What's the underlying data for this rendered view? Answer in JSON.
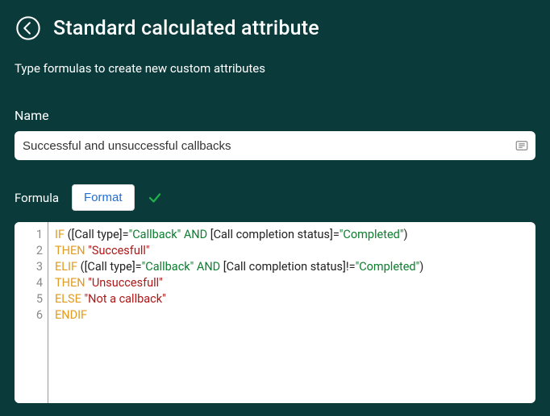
{
  "header": {
    "title": "Standard calculated attribute",
    "subtitle": "Type formulas to create new custom attributes"
  },
  "name": {
    "label": "Name",
    "value": "Successful and unsuccessful callbacks"
  },
  "formula": {
    "label": "Formula",
    "format_label": "Format",
    "lines": [
      [
        {
          "t": "kw",
          "v": "IF "
        },
        {
          "t": "text",
          "v": "([Call type]="
        },
        {
          "t": "bool",
          "v": "\"Callback\""
        },
        {
          "t": "bool",
          "v": " AND "
        },
        {
          "t": "text",
          "v": "[Call completion status]="
        },
        {
          "t": "bool",
          "v": "\"Completed\""
        },
        {
          "t": "text",
          "v": ")"
        }
      ],
      [
        {
          "t": "kw",
          "v": "THEN "
        },
        {
          "t": "str",
          "v": "\"Succesfull\""
        }
      ],
      [
        {
          "t": "kw",
          "v": "ELIF "
        },
        {
          "t": "text",
          "v": "([Call type]="
        },
        {
          "t": "bool",
          "v": "\"Callback\""
        },
        {
          "t": "bool",
          "v": " AND "
        },
        {
          "t": "text",
          "v": "[Call completion status]!="
        },
        {
          "t": "bool",
          "v": "\"Completed\""
        },
        {
          "t": "text",
          "v": ")"
        }
      ],
      [
        {
          "t": "kw",
          "v": "THEN "
        },
        {
          "t": "str",
          "v": "\"Unsuccesfull\""
        }
      ],
      [
        {
          "t": "kw",
          "v": "ELSE "
        },
        {
          "t": "str",
          "v": "\"Not a callback\""
        }
      ],
      [
        {
          "t": "kw",
          "v": "ENDIF"
        }
      ]
    ]
  }
}
